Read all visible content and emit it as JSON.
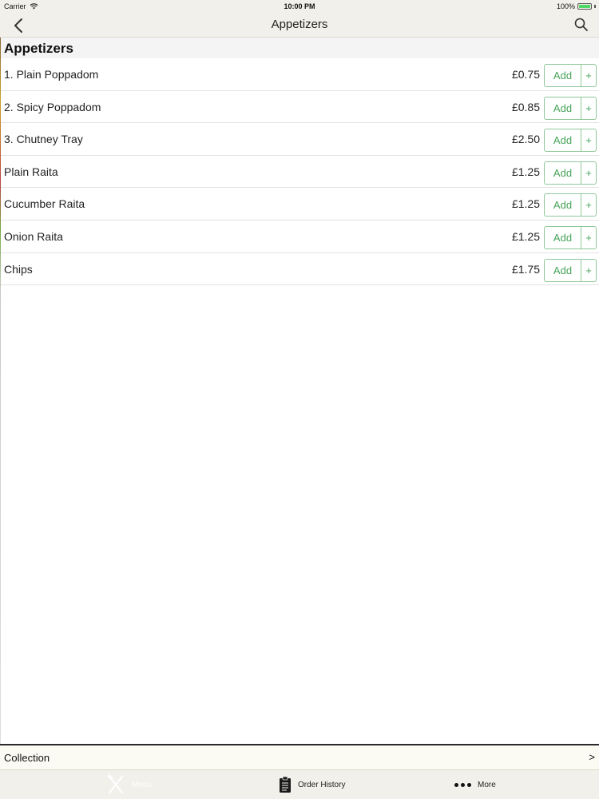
{
  "status_bar": {
    "carrier": "Carrier",
    "time": "10:00 PM",
    "battery": "100%",
    "battery_color": "#4cd964"
  },
  "nav": {
    "title": "Appetizers",
    "back_icon": "chevron-left-icon",
    "search_icon": "search-icon"
  },
  "section": {
    "title": "Appetizers"
  },
  "menu_items": [
    {
      "name": "1. Plain Poppadom",
      "price": "£0.75",
      "add_label": "Add",
      "plus_label": "+"
    },
    {
      "name": "2. Spicy Poppadom",
      "price": "£0.85",
      "add_label": "Add",
      "plus_label": "+"
    },
    {
      "name": "3. Chutney Tray",
      "price": "£2.50",
      "add_label": "Add",
      "plus_label": "+"
    },
    {
      "name": "Plain Raita",
      "price": "£1.25",
      "add_label": "Add",
      "plus_label": "+"
    },
    {
      "name": "Cucumber Raita",
      "price": "£1.25",
      "add_label": "Add",
      "plus_label": "+"
    },
    {
      "name": "Onion Raita",
      "price": "£1.25",
      "add_label": "Add",
      "plus_label": "+"
    },
    {
      "name": "Chips",
      "price": "£1.75",
      "add_label": "Add",
      "plus_label": "+"
    }
  ],
  "collection_bar": {
    "label": "Collection",
    "chevron": ">"
  },
  "tab_bar": {
    "tabs": [
      {
        "label": "Menu",
        "icon": "fork-knife-icon",
        "active": true
      },
      {
        "label": "Order History",
        "icon": "clipboard-icon",
        "active": false
      },
      {
        "label": "More",
        "icon": "more-dots-icon",
        "active": false
      }
    ]
  },
  "colors": {
    "accent_green": "#47a35a",
    "button_border": "#8fc89a",
    "bar_background": "#f1f0ea"
  }
}
